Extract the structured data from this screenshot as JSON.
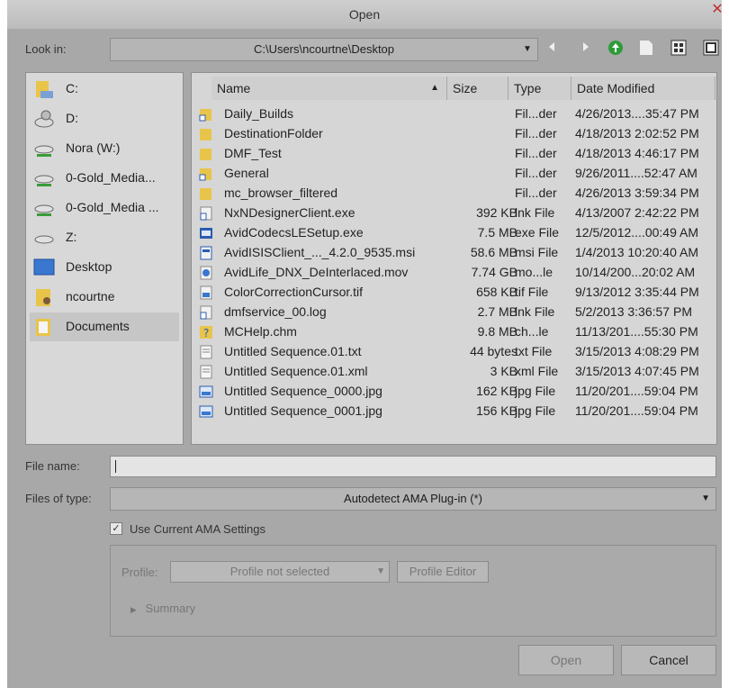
{
  "window": {
    "title": "Open"
  },
  "look_in": {
    "label": "Look in:",
    "path": "C:\\Users\\ncourtne\\Desktop"
  },
  "toolbar": {
    "back_icon": "arrow-left-icon",
    "forward_icon": "arrow-right-icon",
    "up_icon": "up-folder-icon",
    "new_folder_icon": "new-folder-icon",
    "list_view_icon": "list-view-icon",
    "details_view_icon": "details-view-icon"
  },
  "places": [
    {
      "label": "C:",
      "icon": "drive-c-icon"
    },
    {
      "label": "D:",
      "icon": "drive-d-icon"
    },
    {
      "label": "Nora (W:)",
      "icon": "network-drive-icon"
    },
    {
      "label": "0-Gold_Media...",
      "icon": "network-drive-icon"
    },
    {
      "label": "0-Gold_Media ...",
      "icon": "network-drive-icon"
    },
    {
      "label": "Z:",
      "icon": "drive-z-icon"
    },
    {
      "label": "Desktop",
      "icon": "desktop-icon"
    },
    {
      "label": "ncourtne",
      "icon": "user-folder-icon"
    },
    {
      "label": "Documents",
      "icon": "documents-folder-icon"
    }
  ],
  "columns": {
    "name": "Name",
    "size": "Size",
    "type": "Type",
    "date": "Date Modified",
    "sort_icon": "sort-ascending-icon"
  },
  "files": [
    {
      "name": "Daily_Builds",
      "size": "",
      "type": "Fil...der",
      "date": "4/26/2013....35:47 PM",
      "icon": "folder-shortcut-icon"
    },
    {
      "name": "DestinationFolder",
      "size": "",
      "type": "Fil...der",
      "date": "4/18/2013 2:02:52 PM",
      "icon": "folder-icon"
    },
    {
      "name": "DMF_Test",
      "size": "",
      "type": "Fil...der",
      "date": "4/18/2013 4:46:17 PM",
      "icon": "folder-icon"
    },
    {
      "name": "General",
      "size": "",
      "type": "Fil...der",
      "date": "9/26/2011....52:47 AM",
      "icon": "folder-shortcut-icon"
    },
    {
      "name": "mc_browser_filtered",
      "size": "",
      "type": "Fil...der",
      "date": "4/26/2013 3:59:34 PM",
      "icon": "folder-icon"
    },
    {
      "name": "NxNDesignerClient.exe",
      "size": "392 KB",
      "type": "lnk File",
      "date": "4/13/2007 2:42:22 PM",
      "icon": "shortcut-icon"
    },
    {
      "name": "AvidCodecsLESetup.exe",
      "size": "7.5 MB",
      "type": "exe File",
      "date": "12/5/2012....00:49 AM",
      "icon": "installer-icon"
    },
    {
      "name": "AvidISISClient_..._4.2.0_9535.msi",
      "size": "58.6 MB",
      "type": "msi File",
      "date": "1/4/2013 10:20:40 AM",
      "icon": "msi-icon"
    },
    {
      "name": "AvidLife_DNX_DeInterlaced.mov",
      "size": "7.74 GB",
      "type": "mo...le",
      "date": "10/14/200...20:02 AM",
      "icon": "movie-file-icon"
    },
    {
      "name": "ColorCorrectionCursor.tif",
      "size": "658 KB",
      "type": "tif File",
      "date": "9/13/2012 3:35:44 PM",
      "icon": "image-file-icon"
    },
    {
      "name": "dmfservice_00.log",
      "size": "2.7 MB",
      "type": "lnk File",
      "date": "5/2/2013 3:36:57 PM",
      "icon": "shortcut-icon"
    },
    {
      "name": "MCHelp.chm",
      "size": "9.8 MB",
      "type": "ch...le",
      "date": "11/13/201....55:30 PM",
      "icon": "help-file-icon"
    },
    {
      "name": "Untitled Sequence.01.txt",
      "size": "44 bytes",
      "type": "txt File",
      "date": "3/15/2013 4:08:29 PM",
      "icon": "text-file-icon"
    },
    {
      "name": "Untitled Sequence.01.xml",
      "size": "3 KB",
      "type": "xml File",
      "date": "3/15/2013 4:07:45 PM",
      "icon": "text-file-icon"
    },
    {
      "name": "Untitled Sequence_0000.jpg",
      "size": "162 KB",
      "type": "jpg File",
      "date": "11/20/201....59:04 PM",
      "icon": "image-file-icon"
    },
    {
      "name": "Untitled Sequence_0001.jpg",
      "size": "156 KB",
      "type": "jpg File",
      "date": "11/20/201....59:04 PM",
      "icon": "image-file-icon"
    }
  ],
  "file_name": {
    "label": "File name:",
    "value": ""
  },
  "files_of_type": {
    "label": "Files of type:",
    "value": "Autodetect AMA Plug-in (*)"
  },
  "ama": {
    "checkbox_label": "Use Current AMA Settings",
    "checked": true,
    "profile_label": "Profile:",
    "profile_value": "Profile not selected",
    "profile_editor": "Profile Editor",
    "summary": "Summary"
  },
  "actions": {
    "open": "Open",
    "cancel": "Cancel"
  },
  "colors": {
    "bg": "#a8a8a8",
    "panel": "#d6d6d6",
    "accent_green": "#2e9b3a",
    "close_red": "#c03030"
  }
}
